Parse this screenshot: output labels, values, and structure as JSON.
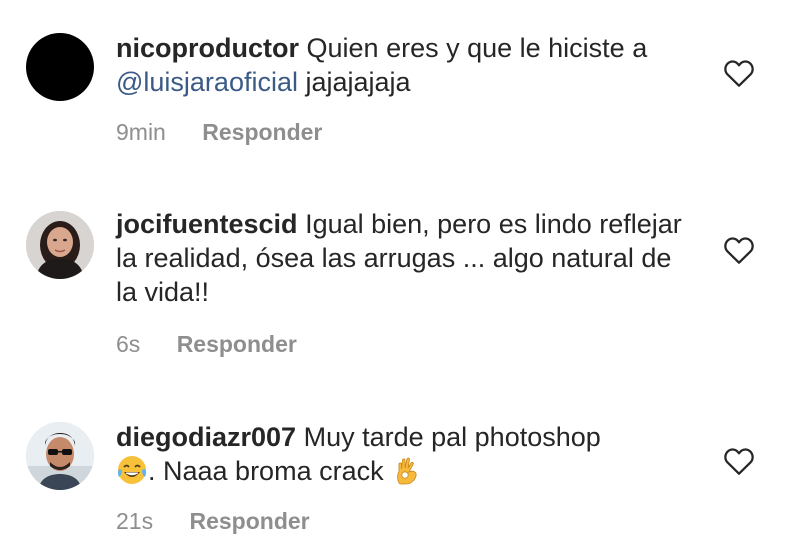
{
  "comments": [
    {
      "username": "nicoproductor",
      "text_parts": [
        "Quien eres y que le hiciste a ",
        "@luisjaraoficial",
        " jajajajaja"
      ],
      "time": "9min",
      "reply_label": "Responder",
      "avatar_icon": "black-circle-avatar"
    },
    {
      "username": "jocifuentescid",
      "text": "Igual bien, pero es lindo reflejar la realidad, ósea las arrugas ... algo natural de la vida!!",
      "time": "6s",
      "reply_label": "Responder",
      "avatar_icon": "woman-photo-avatar"
    },
    {
      "username": "diegodiazr007",
      "text_a": "Muy tarde pal photoshop",
      "text_b": ". Naaa broma crack",
      "emoji_a": "tears-of-joy-emoji",
      "emoji_b": "ok-hand-emoji",
      "time": "21s",
      "reply_label": "Responder",
      "avatar_icon": "man-sunglasses-photo-avatar"
    }
  ],
  "icons": {
    "like": "heart-outline-icon"
  },
  "colors": {
    "text": "#262626",
    "meta": "#8e8e8e",
    "mention": "#3b5a86"
  }
}
